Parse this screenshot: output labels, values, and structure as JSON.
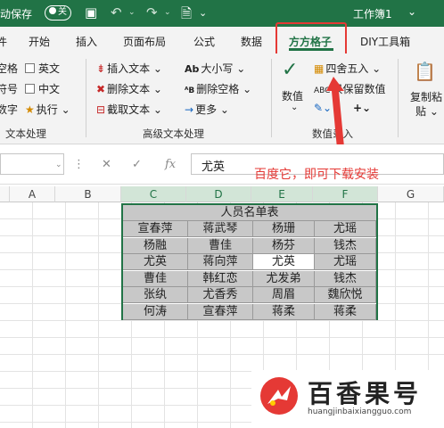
{
  "titlebar": {
    "autosave_label": "动保存",
    "toggle_label": "关",
    "doc_title": "工作簿1",
    "dropdown": "⌄"
  },
  "tabs": [
    "开始",
    "插入",
    "页面布局",
    "公式",
    "数据",
    "方方格子",
    "DIY工具箱"
  ],
  "tabs_partial_left": "件",
  "ribbon": {
    "left_items": [
      "空格",
      "符号",
      "数字"
    ],
    "checkboxes": [
      "英文",
      "中文"
    ],
    "execute": "执行 ⌄",
    "group_text": "文本处理",
    "insert_text": "插入文本 ⌄",
    "delete_text": "删除文本 ⌄",
    "cut_text": "截取文本 ⌄",
    "case": "大小写 ⌄",
    "delete_space": "删除空格 ⌄",
    "more": "更多 ⌄",
    "group_adv": "高级文本处理",
    "value": "数值",
    "round": "四舍五入 ⌄",
    "keep_value": "只保留数值",
    "group_entry": "数值录入",
    "copy_paste": "复制粘",
    "paste": "贴 ⌄"
  },
  "formula": {
    "value": "尤英",
    "fx": "fx"
  },
  "annotation": "百度它，即可下载安装",
  "columns": [
    "A",
    "B",
    "C",
    "D",
    "E",
    "F",
    "G"
  ],
  "table": {
    "title": "人员名单表",
    "rows": [
      [
        "宣春萍",
        "蒋武琴",
        "杨珊",
        "尤瑶"
      ],
      [
        "杨融",
        "曹佳",
        "杨芬",
        "钱杰"
      ],
      [
        "尤英",
        "蒋向萍",
        "尤英",
        "尤瑶"
      ],
      [
        "曹佳",
        "韩红恋",
        "尤发弟",
        "钱杰"
      ],
      [
        "张纨",
        "尤香秀",
        "周眉",
        "魏欣悦"
      ],
      [
        "何涛",
        "宣春萍",
        "蒋柔",
        "蒋柔"
      ]
    ]
  },
  "watermark": {
    "name": "百香果号",
    "url": "huangjinbaixiangguo.com"
  },
  "colors": {
    "accent": "#217346",
    "highlight": "#e53935"
  }
}
